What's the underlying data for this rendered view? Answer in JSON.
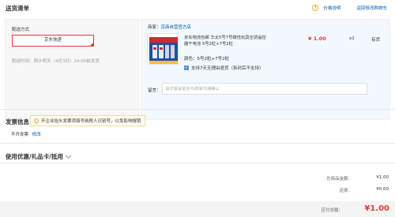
{
  "header": {
    "title": "送货清单",
    "price_note": "价格说明",
    "back_to_cart": "返回修改购物车"
  },
  "shipping": {
    "label": "配送方式",
    "option": "京东快递",
    "time": "配送时间：预计明天（4月3日）24:00前发货"
  },
  "order": {
    "shop_label": "商家：",
    "shop_name": "京商自营官方店",
    "product": {
      "title": "京东物流包邮 华太5号7号碳性玩具空调遥控器干电池 5号2粒+7号2粒",
      "color_label": "颜色：",
      "color_value": "5号2粒+7号2粒",
      "return_policy": "支持7天无理由退货（拆封后不支持）",
      "price": "¥ 1.00",
      "qty": "x1",
      "stock": "有货",
      "image_text": "GP"
    },
    "remark_label": "留言：",
    "remark_placeholder": "请详留言前先与商家沟通确认"
  },
  "invoice": {
    "title": "发票信息",
    "tip": "开企业抬头发票须填写纳税人识别号，以免影响报销",
    "value": "不开发票",
    "modify": "修改"
  },
  "discount": {
    "title": "使用优惠/礼品卡/抵用"
  },
  "summary": {
    "goods_label": "总商品金额：",
    "goods_value": "¥1.00",
    "freight_label": "运费：",
    "freight_value": "¥0.00",
    "pay_label": "应付总额：",
    "pay_value": "¥1.00"
  },
  "colors": {
    "accent_red": "#e4393c",
    "link_blue": "#005aa0",
    "panel_blue": "#f3f8fe"
  }
}
